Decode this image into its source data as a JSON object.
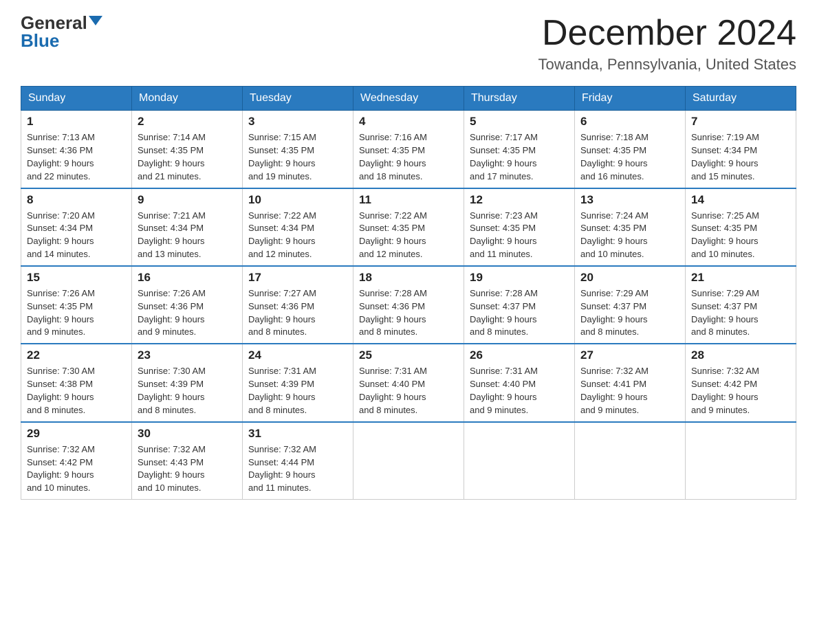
{
  "header": {
    "logo_general": "General",
    "logo_blue": "Blue",
    "title": "December 2024",
    "subtitle": "Towanda, Pennsylvania, United States"
  },
  "weekdays": [
    "Sunday",
    "Monday",
    "Tuesday",
    "Wednesday",
    "Thursday",
    "Friday",
    "Saturday"
  ],
  "weeks": [
    [
      {
        "day": "1",
        "sunrise": "7:13 AM",
        "sunset": "4:36 PM",
        "daylight": "9 hours and 22 minutes."
      },
      {
        "day": "2",
        "sunrise": "7:14 AM",
        "sunset": "4:35 PM",
        "daylight": "9 hours and 21 minutes."
      },
      {
        "day": "3",
        "sunrise": "7:15 AM",
        "sunset": "4:35 PM",
        "daylight": "9 hours and 19 minutes."
      },
      {
        "day": "4",
        "sunrise": "7:16 AM",
        "sunset": "4:35 PM",
        "daylight": "9 hours and 18 minutes."
      },
      {
        "day": "5",
        "sunrise": "7:17 AM",
        "sunset": "4:35 PM",
        "daylight": "9 hours and 17 minutes."
      },
      {
        "day": "6",
        "sunrise": "7:18 AM",
        "sunset": "4:35 PM",
        "daylight": "9 hours and 16 minutes."
      },
      {
        "day": "7",
        "sunrise": "7:19 AM",
        "sunset": "4:34 PM",
        "daylight": "9 hours and 15 minutes."
      }
    ],
    [
      {
        "day": "8",
        "sunrise": "7:20 AM",
        "sunset": "4:34 PM",
        "daylight": "9 hours and 14 minutes."
      },
      {
        "day": "9",
        "sunrise": "7:21 AM",
        "sunset": "4:34 PM",
        "daylight": "9 hours and 13 minutes."
      },
      {
        "day": "10",
        "sunrise": "7:22 AM",
        "sunset": "4:34 PM",
        "daylight": "9 hours and 12 minutes."
      },
      {
        "day": "11",
        "sunrise": "7:22 AM",
        "sunset": "4:35 PM",
        "daylight": "9 hours and 12 minutes."
      },
      {
        "day": "12",
        "sunrise": "7:23 AM",
        "sunset": "4:35 PM",
        "daylight": "9 hours and 11 minutes."
      },
      {
        "day": "13",
        "sunrise": "7:24 AM",
        "sunset": "4:35 PM",
        "daylight": "9 hours and 10 minutes."
      },
      {
        "day": "14",
        "sunrise": "7:25 AM",
        "sunset": "4:35 PM",
        "daylight": "9 hours and 10 minutes."
      }
    ],
    [
      {
        "day": "15",
        "sunrise": "7:26 AM",
        "sunset": "4:35 PM",
        "daylight": "9 hours and 9 minutes."
      },
      {
        "day": "16",
        "sunrise": "7:26 AM",
        "sunset": "4:36 PM",
        "daylight": "9 hours and 9 minutes."
      },
      {
        "day": "17",
        "sunrise": "7:27 AM",
        "sunset": "4:36 PM",
        "daylight": "9 hours and 8 minutes."
      },
      {
        "day": "18",
        "sunrise": "7:28 AM",
        "sunset": "4:36 PM",
        "daylight": "9 hours and 8 minutes."
      },
      {
        "day": "19",
        "sunrise": "7:28 AM",
        "sunset": "4:37 PM",
        "daylight": "9 hours and 8 minutes."
      },
      {
        "day": "20",
        "sunrise": "7:29 AM",
        "sunset": "4:37 PM",
        "daylight": "9 hours and 8 minutes."
      },
      {
        "day": "21",
        "sunrise": "7:29 AM",
        "sunset": "4:37 PM",
        "daylight": "9 hours and 8 minutes."
      }
    ],
    [
      {
        "day": "22",
        "sunrise": "7:30 AM",
        "sunset": "4:38 PM",
        "daylight": "9 hours and 8 minutes."
      },
      {
        "day": "23",
        "sunrise": "7:30 AM",
        "sunset": "4:39 PM",
        "daylight": "9 hours and 8 minutes."
      },
      {
        "day": "24",
        "sunrise": "7:31 AM",
        "sunset": "4:39 PM",
        "daylight": "9 hours and 8 minutes."
      },
      {
        "day": "25",
        "sunrise": "7:31 AM",
        "sunset": "4:40 PM",
        "daylight": "9 hours and 8 minutes."
      },
      {
        "day": "26",
        "sunrise": "7:31 AM",
        "sunset": "4:40 PM",
        "daylight": "9 hours and 9 minutes."
      },
      {
        "day": "27",
        "sunrise": "7:32 AM",
        "sunset": "4:41 PM",
        "daylight": "9 hours and 9 minutes."
      },
      {
        "day": "28",
        "sunrise": "7:32 AM",
        "sunset": "4:42 PM",
        "daylight": "9 hours and 9 minutes."
      }
    ],
    [
      {
        "day": "29",
        "sunrise": "7:32 AM",
        "sunset": "4:42 PM",
        "daylight": "9 hours and 10 minutes."
      },
      {
        "day": "30",
        "sunrise": "7:32 AM",
        "sunset": "4:43 PM",
        "daylight": "9 hours and 10 minutes."
      },
      {
        "day": "31",
        "sunrise": "7:32 AM",
        "sunset": "4:44 PM",
        "daylight": "9 hours and 11 minutes."
      },
      null,
      null,
      null,
      null
    ]
  ],
  "labels": {
    "sunrise": "Sunrise:",
    "sunset": "Sunset:",
    "daylight": "Daylight:"
  }
}
